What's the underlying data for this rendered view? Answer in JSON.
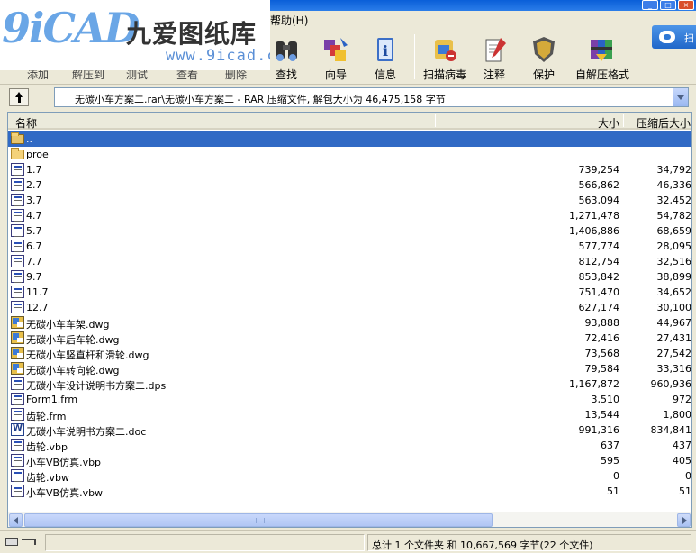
{
  "menubar": {
    "help_label": "帮助(H)"
  },
  "logo": {
    "mark": "9iCAD",
    "chinese": "九爱图纸库",
    "url": "www.9icad.com"
  },
  "toolbar": {
    "ghost_labels": [
      "添加",
      "解压到",
      "测试",
      "查看",
      "删除"
    ],
    "buttons": [
      {
        "label": "查找",
        "icon": "binoculars-icon"
      },
      {
        "label": "向导",
        "icon": "wizard-icon"
      },
      {
        "label": "信息",
        "icon": "info-icon"
      },
      {
        "label": "扫描病毒",
        "icon": "virus-scan-icon"
      },
      {
        "label": "注释",
        "icon": "comment-icon"
      },
      {
        "label": "保护",
        "icon": "shield-icon"
      },
      {
        "label": "自解压格式",
        "icon": "sfx-archive-icon"
      }
    ]
  },
  "side_tab": {
    "label": "扫"
  },
  "address": {
    "path": "无碳小车方案二.rar\\无碳小车方案二 - RAR 压缩文件, 解包大小为 46,475,158 字节"
  },
  "list": {
    "columns": {
      "name": "名称",
      "size": "大小",
      "packed": "压缩后大小"
    },
    "rows": [
      {
        "name": "..",
        "size": "",
        "packed": "",
        "type": "folder",
        "selected": true
      },
      {
        "name": "proe",
        "size": "",
        "packed": "",
        "type": "folder"
      },
      {
        "name": "1.7",
        "size": "739,254",
        "packed": "34,792",
        "type": "file"
      },
      {
        "name": "2.7",
        "size": "566,862",
        "packed": "46,336",
        "type": "file"
      },
      {
        "name": "3.7",
        "size": "563,094",
        "packed": "32,452",
        "type": "file"
      },
      {
        "name": "4.7",
        "size": "1,271,478",
        "packed": "54,782",
        "type": "file"
      },
      {
        "name": "5.7",
        "size": "1,406,886",
        "packed": "68,659",
        "type": "file"
      },
      {
        "name": "6.7",
        "size": "577,774",
        "packed": "28,095",
        "type": "file"
      },
      {
        "name": "7.7",
        "size": "812,754",
        "packed": "32,516",
        "type": "file"
      },
      {
        "name": "9.7",
        "size": "853,842",
        "packed": "38,899",
        "type": "file"
      },
      {
        "name": "11.7",
        "size": "751,470",
        "packed": "34,652",
        "type": "file"
      },
      {
        "name": "12.7",
        "size": "627,174",
        "packed": "30,100",
        "type": "file"
      },
      {
        "name": "无碳小车车架.dwg",
        "size": "93,888",
        "packed": "44,967",
        "type": "dwg"
      },
      {
        "name": "无碳小车后车轮.dwg",
        "size": "72,416",
        "packed": "27,431",
        "type": "dwg"
      },
      {
        "name": "无碳小车竖直杆和滑轮.dwg",
        "size": "73,568",
        "packed": "27,542",
        "type": "dwg"
      },
      {
        "name": "无碳小车转向轮.dwg",
        "size": "79,584",
        "packed": "33,316",
        "type": "dwg"
      },
      {
        "name": "无碳小车设计说明书方案二.dps",
        "size": "1,167,872",
        "packed": "960,936",
        "type": "file"
      },
      {
        "name": "Form1.frm",
        "size": "3,510",
        "packed": "972",
        "type": "file"
      },
      {
        "name": "齿轮.frm",
        "size": "13,544",
        "packed": "1,800",
        "type": "file"
      },
      {
        "name": "无碳小车说明书方案二.doc",
        "size": "991,316",
        "packed": "834,841",
        "type": "doc"
      },
      {
        "name": "齿轮.vbp",
        "size": "637",
        "packed": "437",
        "type": "file"
      },
      {
        "name": "小车VB仿真.vbp",
        "size": "595",
        "packed": "405",
        "type": "file"
      },
      {
        "name": "齿轮.vbw",
        "size": "0",
        "packed": "0",
        "type": "file"
      },
      {
        "name": "小车VB仿真.vbw",
        "size": "51",
        "packed": "51",
        "type": "file"
      }
    ]
  },
  "status": {
    "left": "",
    "right": "总计 1 个文件夹 和 10,667,569 字节(22 个文件)"
  },
  "colors": {
    "selection": "#316ac5",
    "titlebar": "#0a5fd8",
    "face": "#ece9d8"
  }
}
